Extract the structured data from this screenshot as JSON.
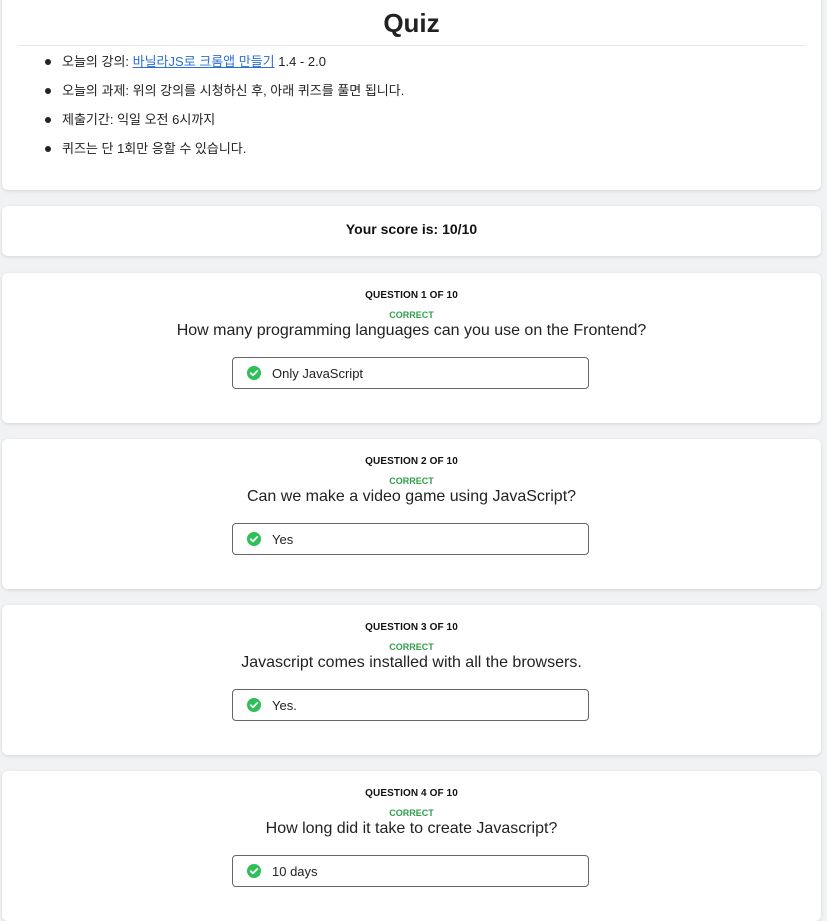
{
  "header": {
    "title": "Quiz",
    "items": [
      {
        "prefix": "오늘의 강의: ",
        "link": "바닐라JS로 크롬앱 만들기",
        "suffix": " 1.4 - 2.0"
      },
      {
        "text": "오늘의 과제: 위의 강의를 시청하신 후, 아래 퀴즈를 풀면 됩니다."
      },
      {
        "text": "제출기간: 익일 오전 6시까지"
      },
      {
        "text": "퀴즈는 단 1회만 응할 수 있습니다."
      }
    ]
  },
  "score": {
    "text": "Your score is: 10/10"
  },
  "questions": [
    {
      "number": "QUESTION 1 OF 10",
      "status": "CORRECT",
      "text": "How many programming languages can you use on the Frontend?",
      "answer": "Only JavaScript"
    },
    {
      "number": "QUESTION 2 OF 10",
      "status": "CORRECT",
      "text": "Can we make a video game using JavaScript?",
      "answer": "Yes"
    },
    {
      "number": "QUESTION 3 OF 10",
      "status": "CORRECT",
      "text": "Javascript comes installed with all the browsers.",
      "answer": "Yes."
    },
    {
      "number": "QUESTION 4 OF 10",
      "status": "CORRECT",
      "text": "How long did it take to create Javascript?",
      "answer": "10 days"
    }
  ],
  "colors": {
    "correct": "#2e9e4a",
    "check_icon": "#2fbf58",
    "link": "#2a6fd6",
    "background": "#f1f2f4"
  },
  "icons": {
    "answer_check": "check-circle-icon"
  }
}
